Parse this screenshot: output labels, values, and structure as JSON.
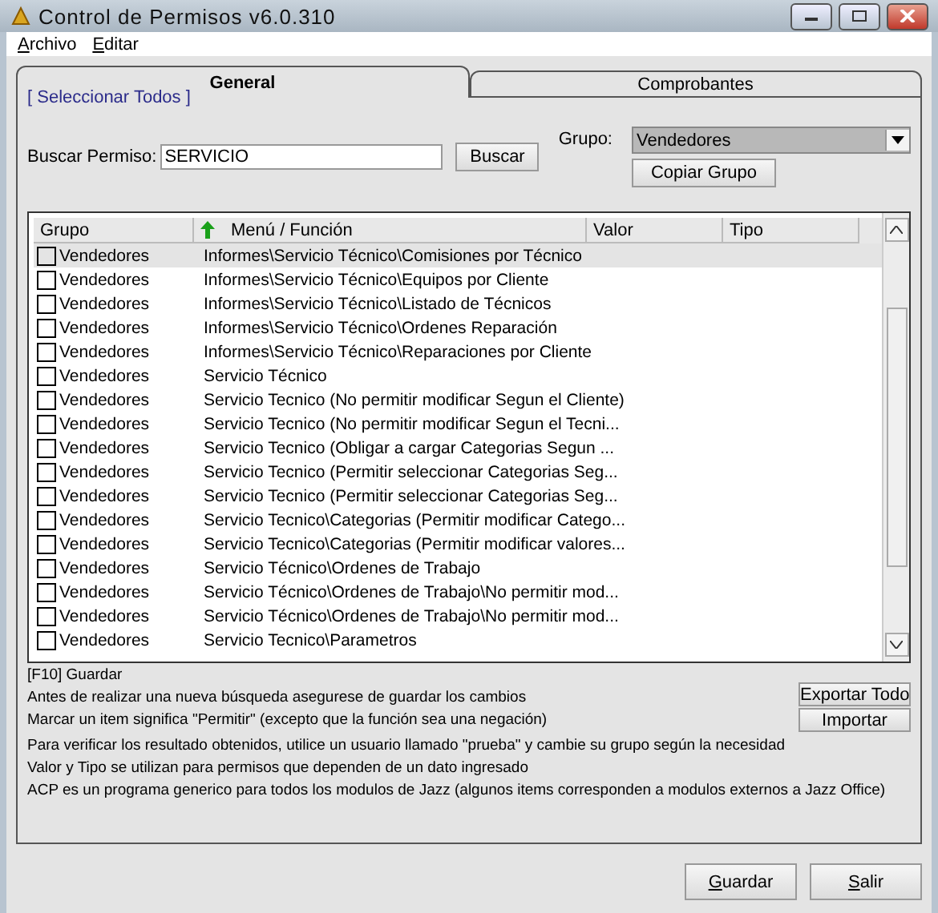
{
  "window": {
    "title": "Control de Permisos v6.0.310"
  },
  "menu": [
    "Archivo",
    "Editar"
  ],
  "tabs": [
    {
      "label": "General",
      "selected": true
    },
    {
      "label": "Comprobantes",
      "selected": false
    }
  ],
  "select_all_link": "[ Seleccionar Todos ]",
  "search": {
    "label": "Buscar Permiso:",
    "value": "SERVICIO",
    "button": "Buscar"
  },
  "group": {
    "label": "Grupo:",
    "value": "Vendedores",
    "copy_button": "Copiar Grupo"
  },
  "table": {
    "columns": [
      {
        "label": "Grupo",
        "sorted": false
      },
      {
        "label": "Menú / Función",
        "sorted": true
      },
      {
        "label": "Valor",
        "sorted": false
      },
      {
        "label": "Tipo",
        "sorted": false
      }
    ],
    "rows": [
      {
        "group": "Vendedores",
        "function": "Informes\\Servicio Técnico\\Comisiones por Técnico",
        "checked": false,
        "selected": true
      },
      {
        "group": "Vendedores",
        "function": "Informes\\Servicio Técnico\\Equipos por Cliente",
        "checked": false,
        "selected": false
      },
      {
        "group": "Vendedores",
        "function": "Informes\\Servicio Técnico\\Listado de Técnicos",
        "checked": false,
        "selected": false
      },
      {
        "group": "Vendedores",
        "function": "Informes\\Servicio Técnico\\Ordenes Reparación",
        "checked": false,
        "selected": false
      },
      {
        "group": "Vendedores",
        "function": "Informes\\Servicio Técnico\\Reparaciones por Cliente",
        "checked": false,
        "selected": false
      },
      {
        "group": "Vendedores",
        "function": "Servicio Técnico",
        "checked": false,
        "selected": false
      },
      {
        "group": "Vendedores",
        "function": "Servicio Tecnico (No permitir modificar Segun el Cliente)",
        "checked": false,
        "selected": false
      },
      {
        "group": "Vendedores",
        "function": "Servicio Tecnico (No permitir modificar Segun el Tecni...",
        "checked": false,
        "selected": false
      },
      {
        "group": "Vendedores",
        "function": "Servicio Tecnico (Obligar a cargar Categorias Segun ...",
        "checked": false,
        "selected": false
      },
      {
        "group": "Vendedores",
        "function": "Servicio Tecnico (Permitir seleccionar Categorias Seg...",
        "checked": false,
        "selected": false
      },
      {
        "group": "Vendedores",
        "function": "Servicio Tecnico (Permitir seleccionar Categorias Seg...",
        "checked": false,
        "selected": false
      },
      {
        "group": "Vendedores",
        "function": "Servicio Tecnico\\Categorias (Permitir modificar Catego...",
        "checked": false,
        "selected": false
      },
      {
        "group": "Vendedores",
        "function": "Servicio Tecnico\\Categorias (Permitir modificar valores...",
        "checked": false,
        "selected": false
      },
      {
        "group": "Vendedores",
        "function": "Servicio Técnico\\Ordenes de Trabajo",
        "checked": false,
        "selected": false
      },
      {
        "group": "Vendedores",
        "function": "Servicio Técnico\\Ordenes de Trabajo\\No permitir mod...",
        "checked": false,
        "selected": false
      },
      {
        "group": "Vendedores",
        "function": "Servicio Técnico\\Ordenes de Trabajo\\No permitir mod...",
        "checked": false,
        "selected": false
      },
      {
        "group": "Vendedores",
        "function": "Servicio Tecnico\\Parametros",
        "checked": false,
        "selected": false
      }
    ]
  },
  "shortcut_note": "[F10] Guardar",
  "notes": [
    "Antes de realizar una nueva búsqueda asegurese de guardar los cambios",
    "Marcar un item significa \"Permitir\" (excepto que la función sea una negación)",
    "Para verificar los resultado obtenidos, utilice un usuario llamado \"prueba\" y cambie su grupo según la necesidad",
    "Valor y Tipo se utilizan para permisos que dependen de un dato ingresado",
    "ACP es un programa generico para todos los modulos de Jazz (algunos items corresponden a modulos externos a Jazz Office)"
  ],
  "side_buttons": [
    "Exportar Todo",
    "Importar"
  ],
  "footer_buttons": [
    "Guardar",
    "Salir"
  ]
}
